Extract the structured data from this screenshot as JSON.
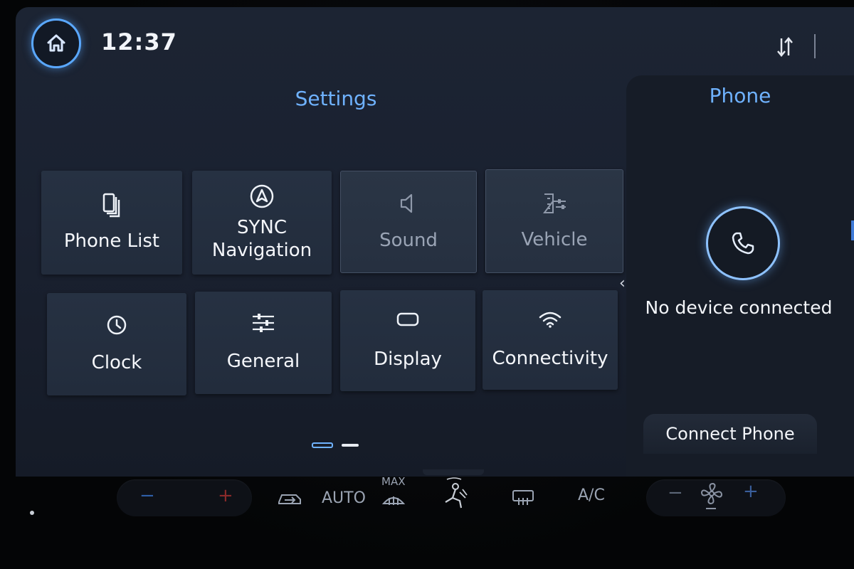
{
  "status": {
    "time": "12:37"
  },
  "settings": {
    "title": "Settings",
    "tiles": [
      {
        "label": "Phone List",
        "icon": "phone-list-icon",
        "enabled": true
      },
      {
        "label": "SYNC\nNavigation",
        "icon": "navigation-icon",
        "enabled": true
      },
      {
        "label": "Sound",
        "icon": "speaker-icon",
        "enabled": false
      },
      {
        "label": "Vehicle",
        "icon": "vehicle-icon",
        "enabled": false
      },
      {
        "label": "Clock",
        "icon": "clock-icon",
        "enabled": true
      },
      {
        "label": "General",
        "icon": "sliders-icon",
        "enabled": true
      },
      {
        "label": "Display",
        "icon": "display-icon",
        "enabled": true
      },
      {
        "label": "Connectivity",
        "icon": "wifi-icon",
        "enabled": true
      }
    ],
    "page_count": 2,
    "current_page": 1
  },
  "phone": {
    "title": "Phone",
    "status": "No device connected",
    "connect_label": "Connect Phone"
  },
  "climate": {
    "auto_label": "AUTO",
    "max_label": "MAX",
    "ac_label": "A/C",
    "minus": "−",
    "plus": "+"
  },
  "colors": {
    "accent": "#6fb2ff",
    "tile": "#263142",
    "background": "#1a2130"
  }
}
